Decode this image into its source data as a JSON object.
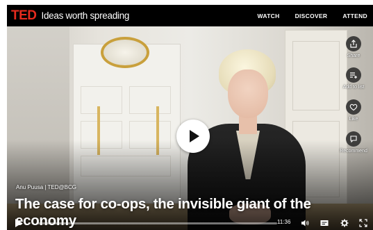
{
  "header": {
    "logo": "TED",
    "tagline": "Ideas worth spreading",
    "nav": [
      "WATCH",
      "DISCOVER",
      "ATTEND"
    ]
  },
  "video": {
    "speaker_line": "Anu Puusa | TED@BCG",
    "title": "The case for co-ops, the invisible giant of the economy",
    "time": "11:36",
    "progress": 0.0
  },
  "side_actions": [
    {
      "label": "Share",
      "icon": "share-icon"
    },
    {
      "label": "Add to list",
      "icon": "add-to-list-icon"
    },
    {
      "label": "Like",
      "icon": "heart-icon"
    },
    {
      "label": "Recommend",
      "icon": "recommend-icon"
    }
  ],
  "colors": {
    "brand": "#e62b1e",
    "bar": "#000000",
    "text": "#ffffff"
  }
}
